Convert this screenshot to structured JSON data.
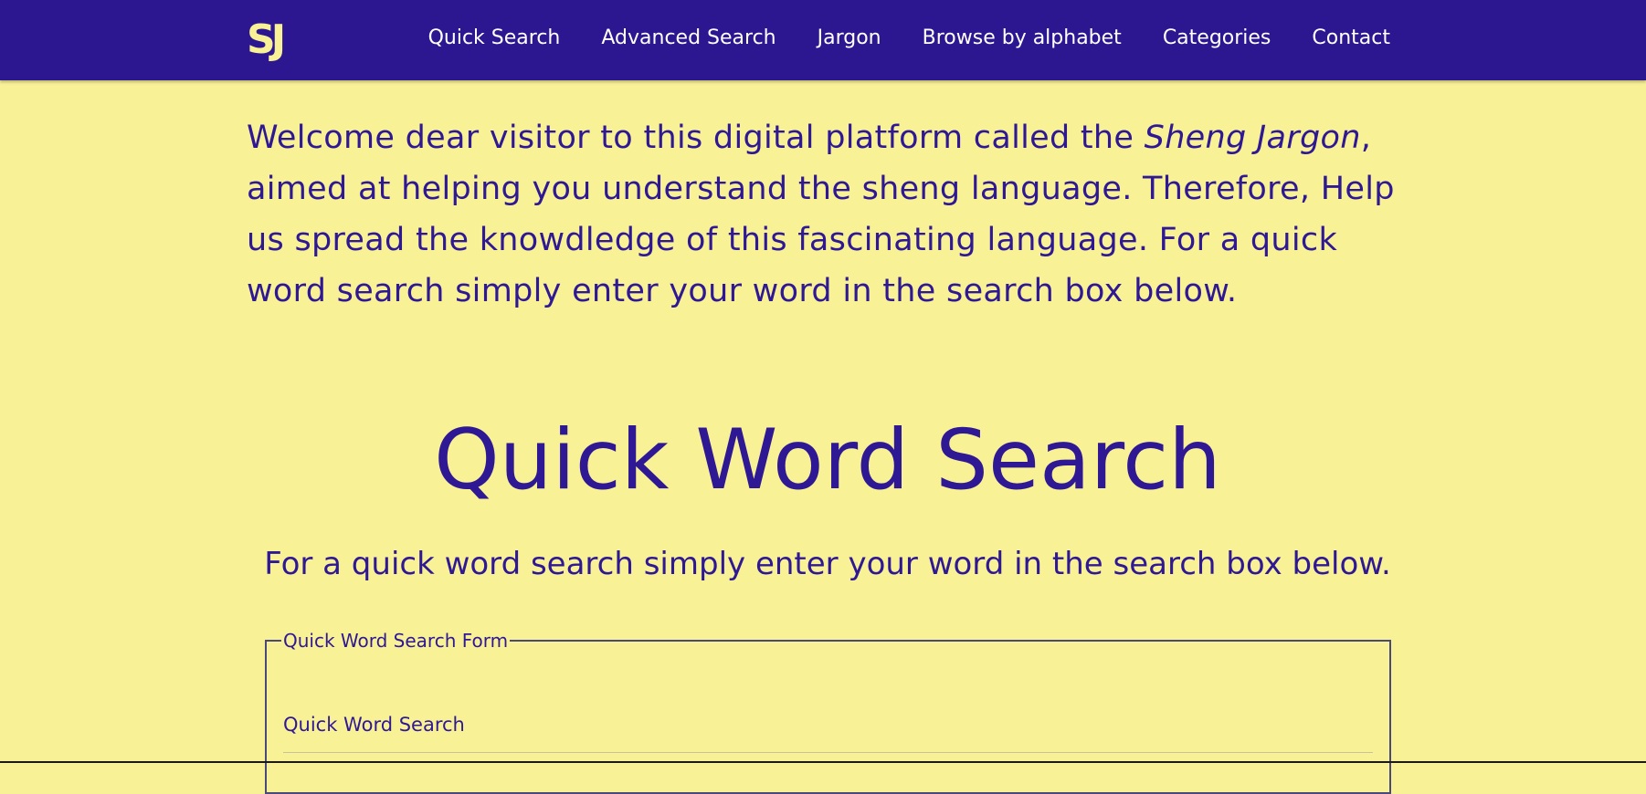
{
  "header": {
    "logo": "SJ",
    "nav": [
      {
        "label": "Quick Search"
      },
      {
        "label": "Advanced Search"
      },
      {
        "label": "Jargon"
      },
      {
        "label": "Browse by alphabet"
      },
      {
        "label": "Categories"
      },
      {
        "label": "Contact"
      }
    ]
  },
  "intro": {
    "before": "Welcome dear visitor to this digital platform called the ",
    "emphasis": "Sheng Jargon",
    "after": ", aimed at helping you understand the sheng language. Therefore, Help us spread the knowdledge of this fascinating language. For a quick word search simply enter your word in the search box below."
  },
  "hero": {
    "title": "Quick Word Search",
    "subtitle": "For a quick word search simply enter your word in the search box below."
  },
  "search_form": {
    "legend": "Quick Word Search Form",
    "label": "Quick Word Search",
    "value": ""
  },
  "colors": {
    "background": "#f8f196",
    "navbar": "#2c1790",
    "text": "#2f1894"
  }
}
